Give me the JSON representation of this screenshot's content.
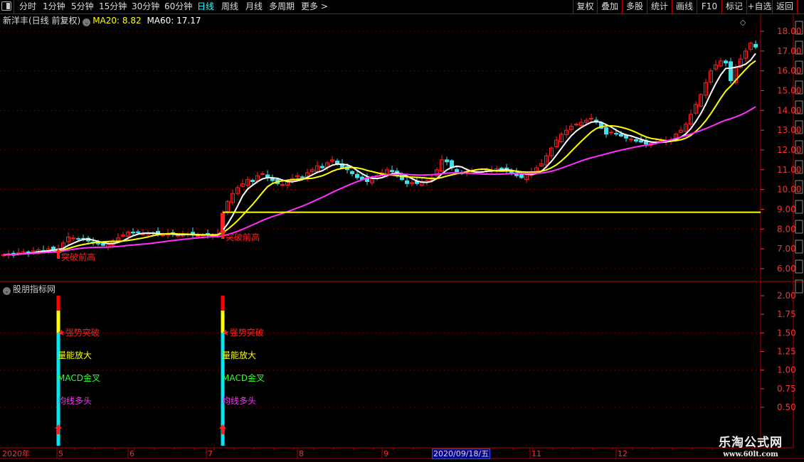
{
  "toolbar": {
    "periods": [
      "分时",
      "1分钟",
      "5分钟",
      "15分钟",
      "30分钟",
      "60分钟",
      "日线",
      "周线",
      "月线",
      "多周期",
      "更多 >"
    ],
    "active_period": "日线",
    "actions": [
      "复权",
      "叠加",
      "多股",
      "统计",
      "画线",
      "F10",
      "标记",
      "+自选",
      "返回"
    ]
  },
  "info": {
    "stock_title": "新洋丰(日线 前复权)",
    "ma20_label": "MA20: 8.82",
    "ma60_label": "MA60: 17.17"
  },
  "indicator": {
    "title": "股朋指标网",
    "signals": [
      "★强势突破",
      "量能放大",
      "MACD金叉",
      "均线多头"
    ]
  },
  "annotations": {
    "breakout_label": "突破前高"
  },
  "time_axis": {
    "year_label": "2020年",
    "months": [
      "5",
      "6",
      "7",
      "8",
      "9",
      "11",
      "12"
    ],
    "cursor_date": "2020/09/18/五"
  },
  "watermark": {
    "name": "乐淘公式网",
    "url": "www.60lt.com"
  },
  "colors": {
    "up": "#ff2020",
    "down": "#40e0e8",
    "ma_short": "#ffffff",
    "ma_mid": "#ffff00",
    "ma_long": "#ff30ff",
    "axis": "#ff3030",
    "frame": "#b00000"
  },
  "chart_data": [
    {
      "type": "candlestick",
      "price_axis_ticks": [
        "18.00",
        "17.00",
        "16.00",
        "15.00",
        "14.00",
        "13.00",
        "12.00",
        "11.00",
        "10.00",
        "9.00",
        "8.00",
        "7.00",
        "6.00"
      ],
      "ylim": [
        5.5,
        18.5
      ],
      "closes": [
        6.7,
        6.75,
        6.68,
        6.8,
        6.85,
        6.78,
        6.9,
        6.95,
        6.88,
        7.0,
        6.95,
        7.02,
        7.3,
        7.6,
        7.55,
        7.5,
        7.45,
        7.4,
        7.3,
        7.25,
        7.18,
        7.22,
        7.4,
        7.55,
        7.7,
        7.85,
        7.8,
        7.82,
        7.75,
        7.78,
        7.8,
        7.72,
        7.7,
        7.76,
        7.74,
        7.68,
        7.72,
        7.75,
        7.7,
        7.66,
        7.72,
        7.7,
        7.68,
        7.75,
        8.8,
        9.4,
        9.8,
        10.1,
        10.3,
        10.5,
        10.4,
        10.7,
        10.8,
        10.6,
        10.45,
        10.3,
        10.25,
        10.4,
        10.55,
        10.7,
        10.6,
        10.85,
        11.0,
        11.2,
        11.1,
        11.35,
        11.5,
        11.3,
        11.1,
        11.0,
        10.8,
        10.6,
        10.5,
        10.4,
        10.55,
        10.7,
        10.85,
        11.0,
        10.9,
        10.7,
        10.5,
        10.3,
        10.35,
        10.3,
        10.4,
        10.45,
        10.6,
        11.0,
        11.5,
        11.4,
        11.1,
        10.9,
        10.8,
        10.85,
        10.95,
        10.9,
        10.9,
        11.0,
        10.95,
        11.05,
        11.0,
        11.0,
        10.85,
        10.7,
        10.6,
        10.75,
        10.9,
        11.1,
        11.3,
        11.7,
        12.1,
        12.5,
        12.8,
        13.0,
        13.2,
        13.3,
        13.4,
        13.5,
        13.6,
        13.4,
        13.1,
        12.8,
        12.9,
        12.8,
        12.7,
        12.6,
        12.55,
        12.45,
        12.4,
        12.3,
        12.35,
        12.4,
        12.5,
        12.45,
        12.5,
        12.8,
        13.0,
        13.3,
        13.8,
        14.3,
        14.8,
        15.4,
        16.0,
        16.3,
        16.5,
        16.4,
        15.5,
        16.2,
        16.6,
        17.0,
        17.4,
        17.2
      ],
      "ma_periods": [
        5,
        10,
        30
      ],
      "reference_line": 8.85,
      "breakout_bars": [
        11,
        44
      ]
    },
    {
      "type": "bar",
      "indicator_axis_ticks": [
        "2.00",
        "1.75",
        "1.50",
        "1.25",
        "1.00",
        "0.75",
        "0.50"
      ],
      "ylim": [
        0,
        2.1
      ],
      "signal_bars": [
        11,
        44
      ],
      "segments": [
        {
          "from": 0,
          "to": 1.5,
          "color": "#00e8f0"
        },
        {
          "from": 1.5,
          "to": 1.8,
          "color": "#ffff00"
        },
        {
          "from": 1.8,
          "to": 2.0,
          "color": "#ff0000"
        }
      ]
    }
  ]
}
